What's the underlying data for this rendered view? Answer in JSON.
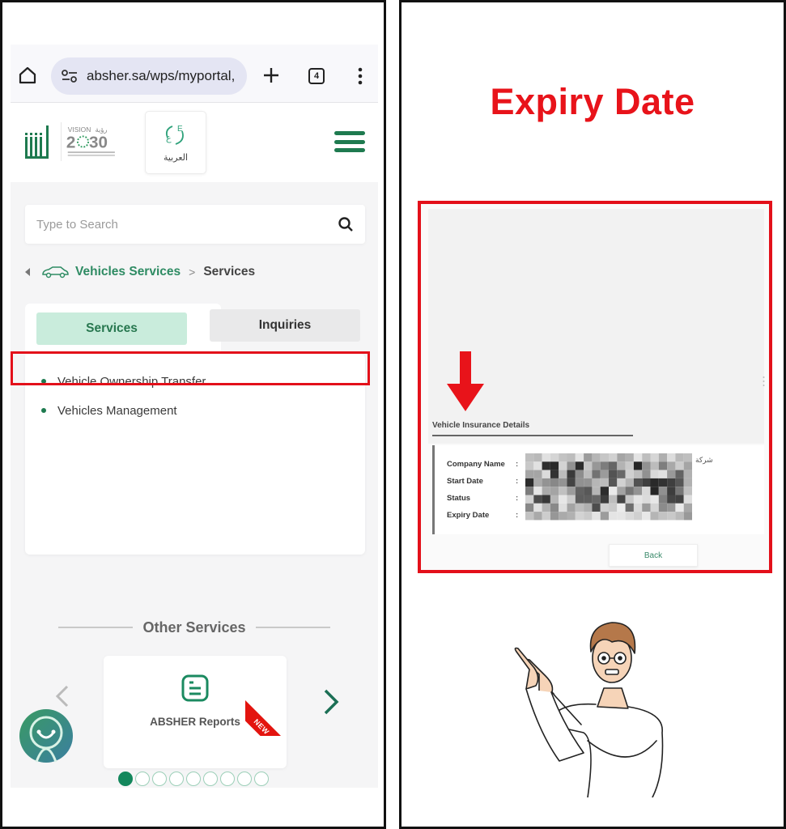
{
  "browser": {
    "url": "absher.sa/wps/myportal,",
    "tab_count": "4"
  },
  "header": {
    "language_button": "العربية",
    "logo_alt": "Absher",
    "vision_logo": "Vision 2030"
  },
  "search": {
    "placeholder": "Type to Search"
  },
  "breadcrumb": {
    "parent": "Vehicles Services",
    "separator": ">",
    "current": "Services"
  },
  "tabs": [
    {
      "label": "Services",
      "active": true
    },
    {
      "label": "Inquiries",
      "active": false
    }
  ],
  "services_list": [
    {
      "label": "Vehicle Ownership Transfer"
    },
    {
      "label": "Vehicles Management",
      "highlighted": true
    }
  ],
  "other_services": {
    "title": "Other Services",
    "card": {
      "label": "ABSHER Reports",
      "badge": "NEW"
    },
    "pager": {
      "total": 9,
      "active": 1
    }
  },
  "annotation": {
    "heading": "Expiry Date",
    "highlight_color": "#e3101a"
  },
  "insurance": {
    "title": "Vehicle Insurance Details",
    "fields": [
      {
        "label": "Company Name",
        "value": "شركة"
      },
      {
        "label": "Start Date",
        "value": ""
      },
      {
        "label": "Status",
        "value": ""
      },
      {
        "label": "Expiry Date",
        "value": ""
      }
    ],
    "back_button": "Back"
  },
  "colors": {
    "brand_green": "#1e7a4f",
    "accent_red": "#e8131a"
  }
}
